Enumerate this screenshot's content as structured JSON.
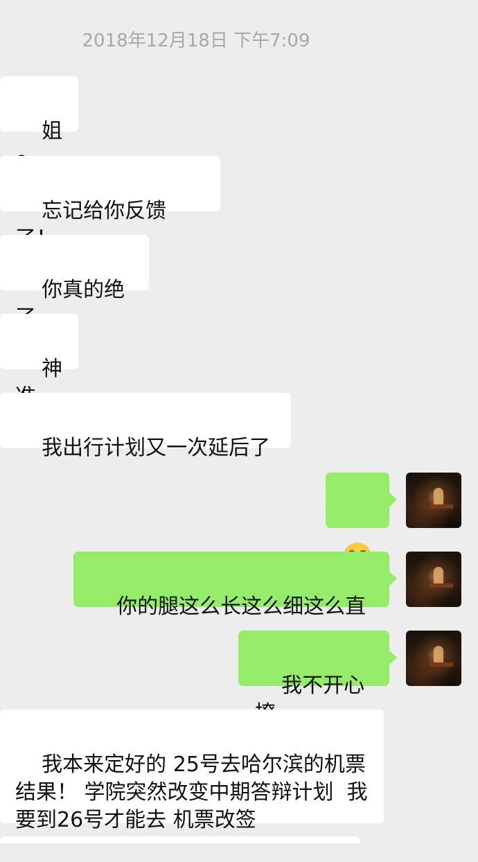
{
  "chat": {
    "timestamp": "2018年12月18日 下午7:09",
    "messages": [
      {
        "side": "in",
        "text": "姐～"
      },
      {
        "side": "in",
        "text": "忘记给你反馈了！"
      },
      {
        "side": "in",
        "text": "你真的绝了"
      },
      {
        "side": "in",
        "text": "神准"
      },
      {
        "side": "in",
        "text": "我出行计划又一次延后了"
      },
      {
        "side": "out",
        "emoji": "tears-of-joy-emoji"
      },
      {
        "side": "out",
        "text": "你的腿这么长这么细这么直"
      },
      {
        "side": "out",
        "text": "我不开心撩"
      },
      {
        "side": "in",
        "text": "我本来定好的 25号去哈尔滨的机票 结果！ 学院突然改变中期答辩计划  我要到26号才能去 机票改签"
      }
    ]
  },
  "colors": {
    "background": "#ededed",
    "incoming_bubble": "#ffffff",
    "outgoing_bubble": "#95ec69",
    "timestamp_text": "#a8a8a8"
  }
}
